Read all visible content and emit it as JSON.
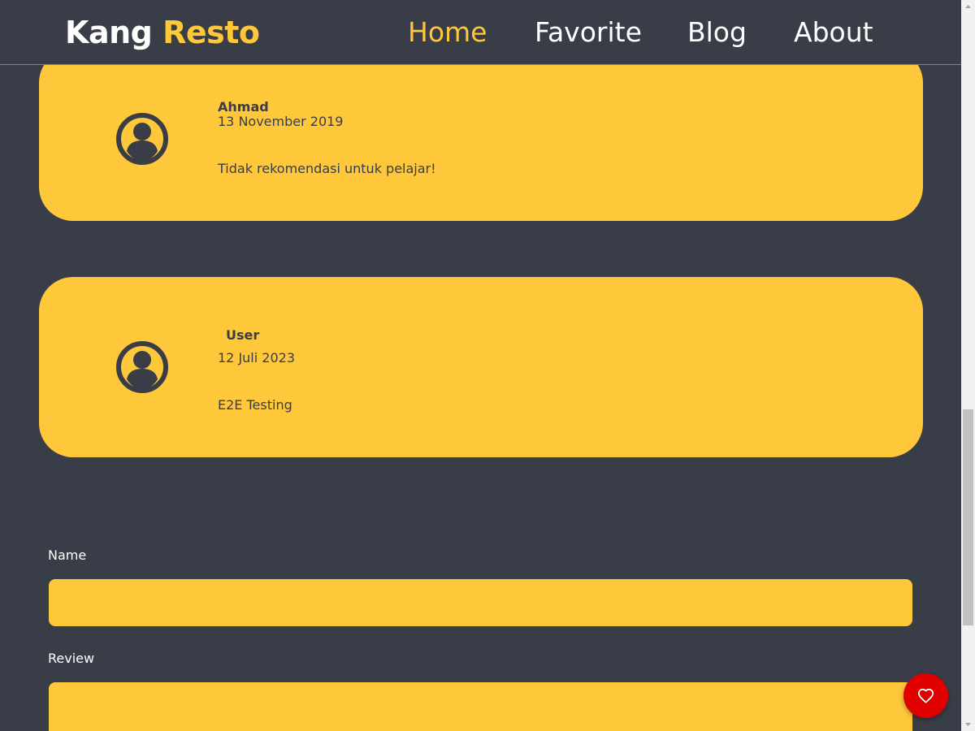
{
  "header": {
    "brand_part1": "Kang",
    "brand_part2": "Resto",
    "nav": [
      "Home",
      "Favorite",
      "Blog",
      "About"
    ],
    "active_nav": "Home"
  },
  "reviews": [
    {
      "name": "Ahmad",
      "date": "13 November 2019",
      "review": "Tidak rekomendasi untuk pelajar!"
    },
    {
      "name": "User",
      "date": "12 Juli 2023",
      "review": "E2E Testing"
    }
  ],
  "form": {
    "name_label": "Name",
    "name_value": "",
    "review_label": "Review",
    "review_value": ""
  },
  "icons": {
    "avatar": "user-circle-icon",
    "favorite": "heart-outline-icon"
  },
  "colors": {
    "background": "#393d47",
    "accent": "#ffc83a",
    "favorite_button": "#e00000",
    "text_dark": "#3a3d46"
  }
}
